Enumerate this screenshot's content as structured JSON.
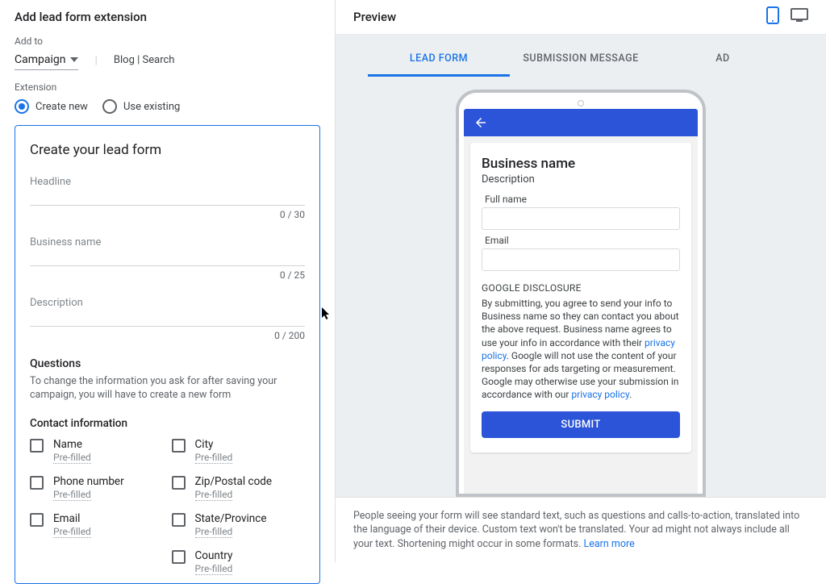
{
  "left": {
    "page_title": "Add lead form extension",
    "add_to_label": "Add to",
    "campaign_label": "Campaign",
    "campaign_value": "Blog | Search",
    "extension_label": "Extension",
    "radio": {
      "create_new": "Create new",
      "use_existing": "Use existing"
    },
    "form_card_title": "Create your lead form",
    "fields": {
      "headline": {
        "label": "Headline",
        "counter": "0 / 30"
      },
      "business": {
        "label": "Business name",
        "counter": "0 / 25"
      },
      "description": {
        "label": "Description",
        "counter": "0 / 200"
      }
    },
    "questions_head": "Questions",
    "questions_hint": "To change the information you ask for after saving your campaign, you will have to create a new form",
    "contact_head": "Contact information",
    "prefilled": "Pre-filled",
    "contact_items_left": [
      "Name",
      "Phone number",
      "Email"
    ],
    "contact_items_right": [
      "City",
      "Zip/Postal code",
      "State/Province",
      "Country"
    ]
  },
  "right": {
    "preview_label": "Preview",
    "tabs": {
      "lead": "LEAD FORM",
      "msg": "SUBMISSION MESSAGE",
      "ad": "AD"
    },
    "preview_card": {
      "title": "Business name",
      "desc": "Description",
      "field_fullname": "Full name",
      "field_email": "Email",
      "disclosure_head": "GOOGLE DISCLOSURE",
      "disclosure_1": "By submitting, you agree to send your info to Business name so they can contact you about the above request. Business name agrees to use your info in accordance with their ",
      "privacy1": "privacy policy",
      "disclosure_2": ". Google will not use the content of your responses for ads targeting or measurement. Google may otherwise use your submission in accordance with our ",
      "privacy2": "privacy policy",
      "period": ".",
      "submit": "SUBMIT"
    },
    "footer_note": "People seeing your form will see standard text, such as questions and calls-to-action, translated into the language of their device. Custom text won't be translated. Your ad might not always include all your text. Shortening might occur in some formats. ",
    "learn_more": "Learn more"
  }
}
